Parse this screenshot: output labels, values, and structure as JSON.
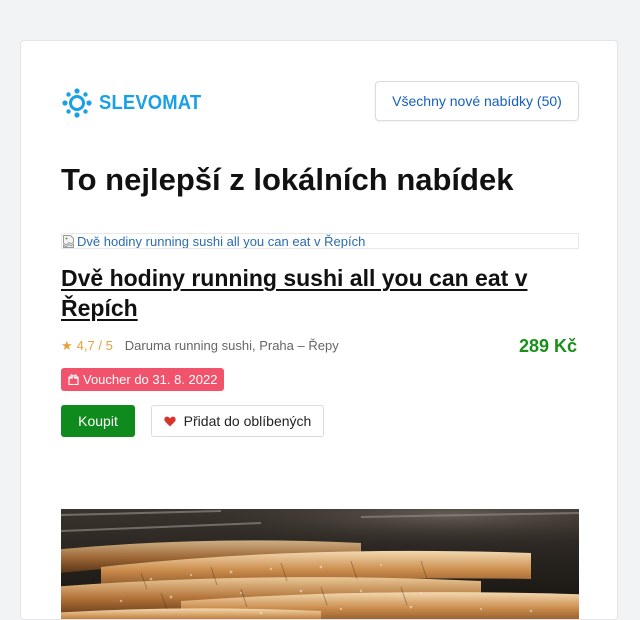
{
  "brand": {
    "name": "SLEVOMAT",
    "color": "#1aa0e6",
    "icon": "gear-logo-icon"
  },
  "header": {
    "all_offers_label": "Všechny nové nabídky (50)"
  },
  "page_title": "To nejlepší z lokálních nabídek",
  "deal": {
    "image_alt": "Dvě hodiny running sushi all you can eat v Řepích",
    "title": "Dvě hodiny running sushi all you can eat v Řepích",
    "rating": "4,7 / 5",
    "vendor": "Daruma running sushi, Praha – Řepy",
    "price": "289 Kč",
    "voucher": "Voucher do 31. 8. 2022",
    "buy_label": "Koupit",
    "favorite_label": "Přidat do oblíbených"
  },
  "colors": {
    "price": "#1a8f1a",
    "badge": "#f0536b",
    "buy": "#0f8a1d",
    "rating": "#e8a13a",
    "heart": "#d9342b"
  },
  "icons": {
    "rating": "star-icon",
    "voucher": "gift-icon",
    "favorite": "heart-icon",
    "broken_image": "broken-image-icon"
  }
}
